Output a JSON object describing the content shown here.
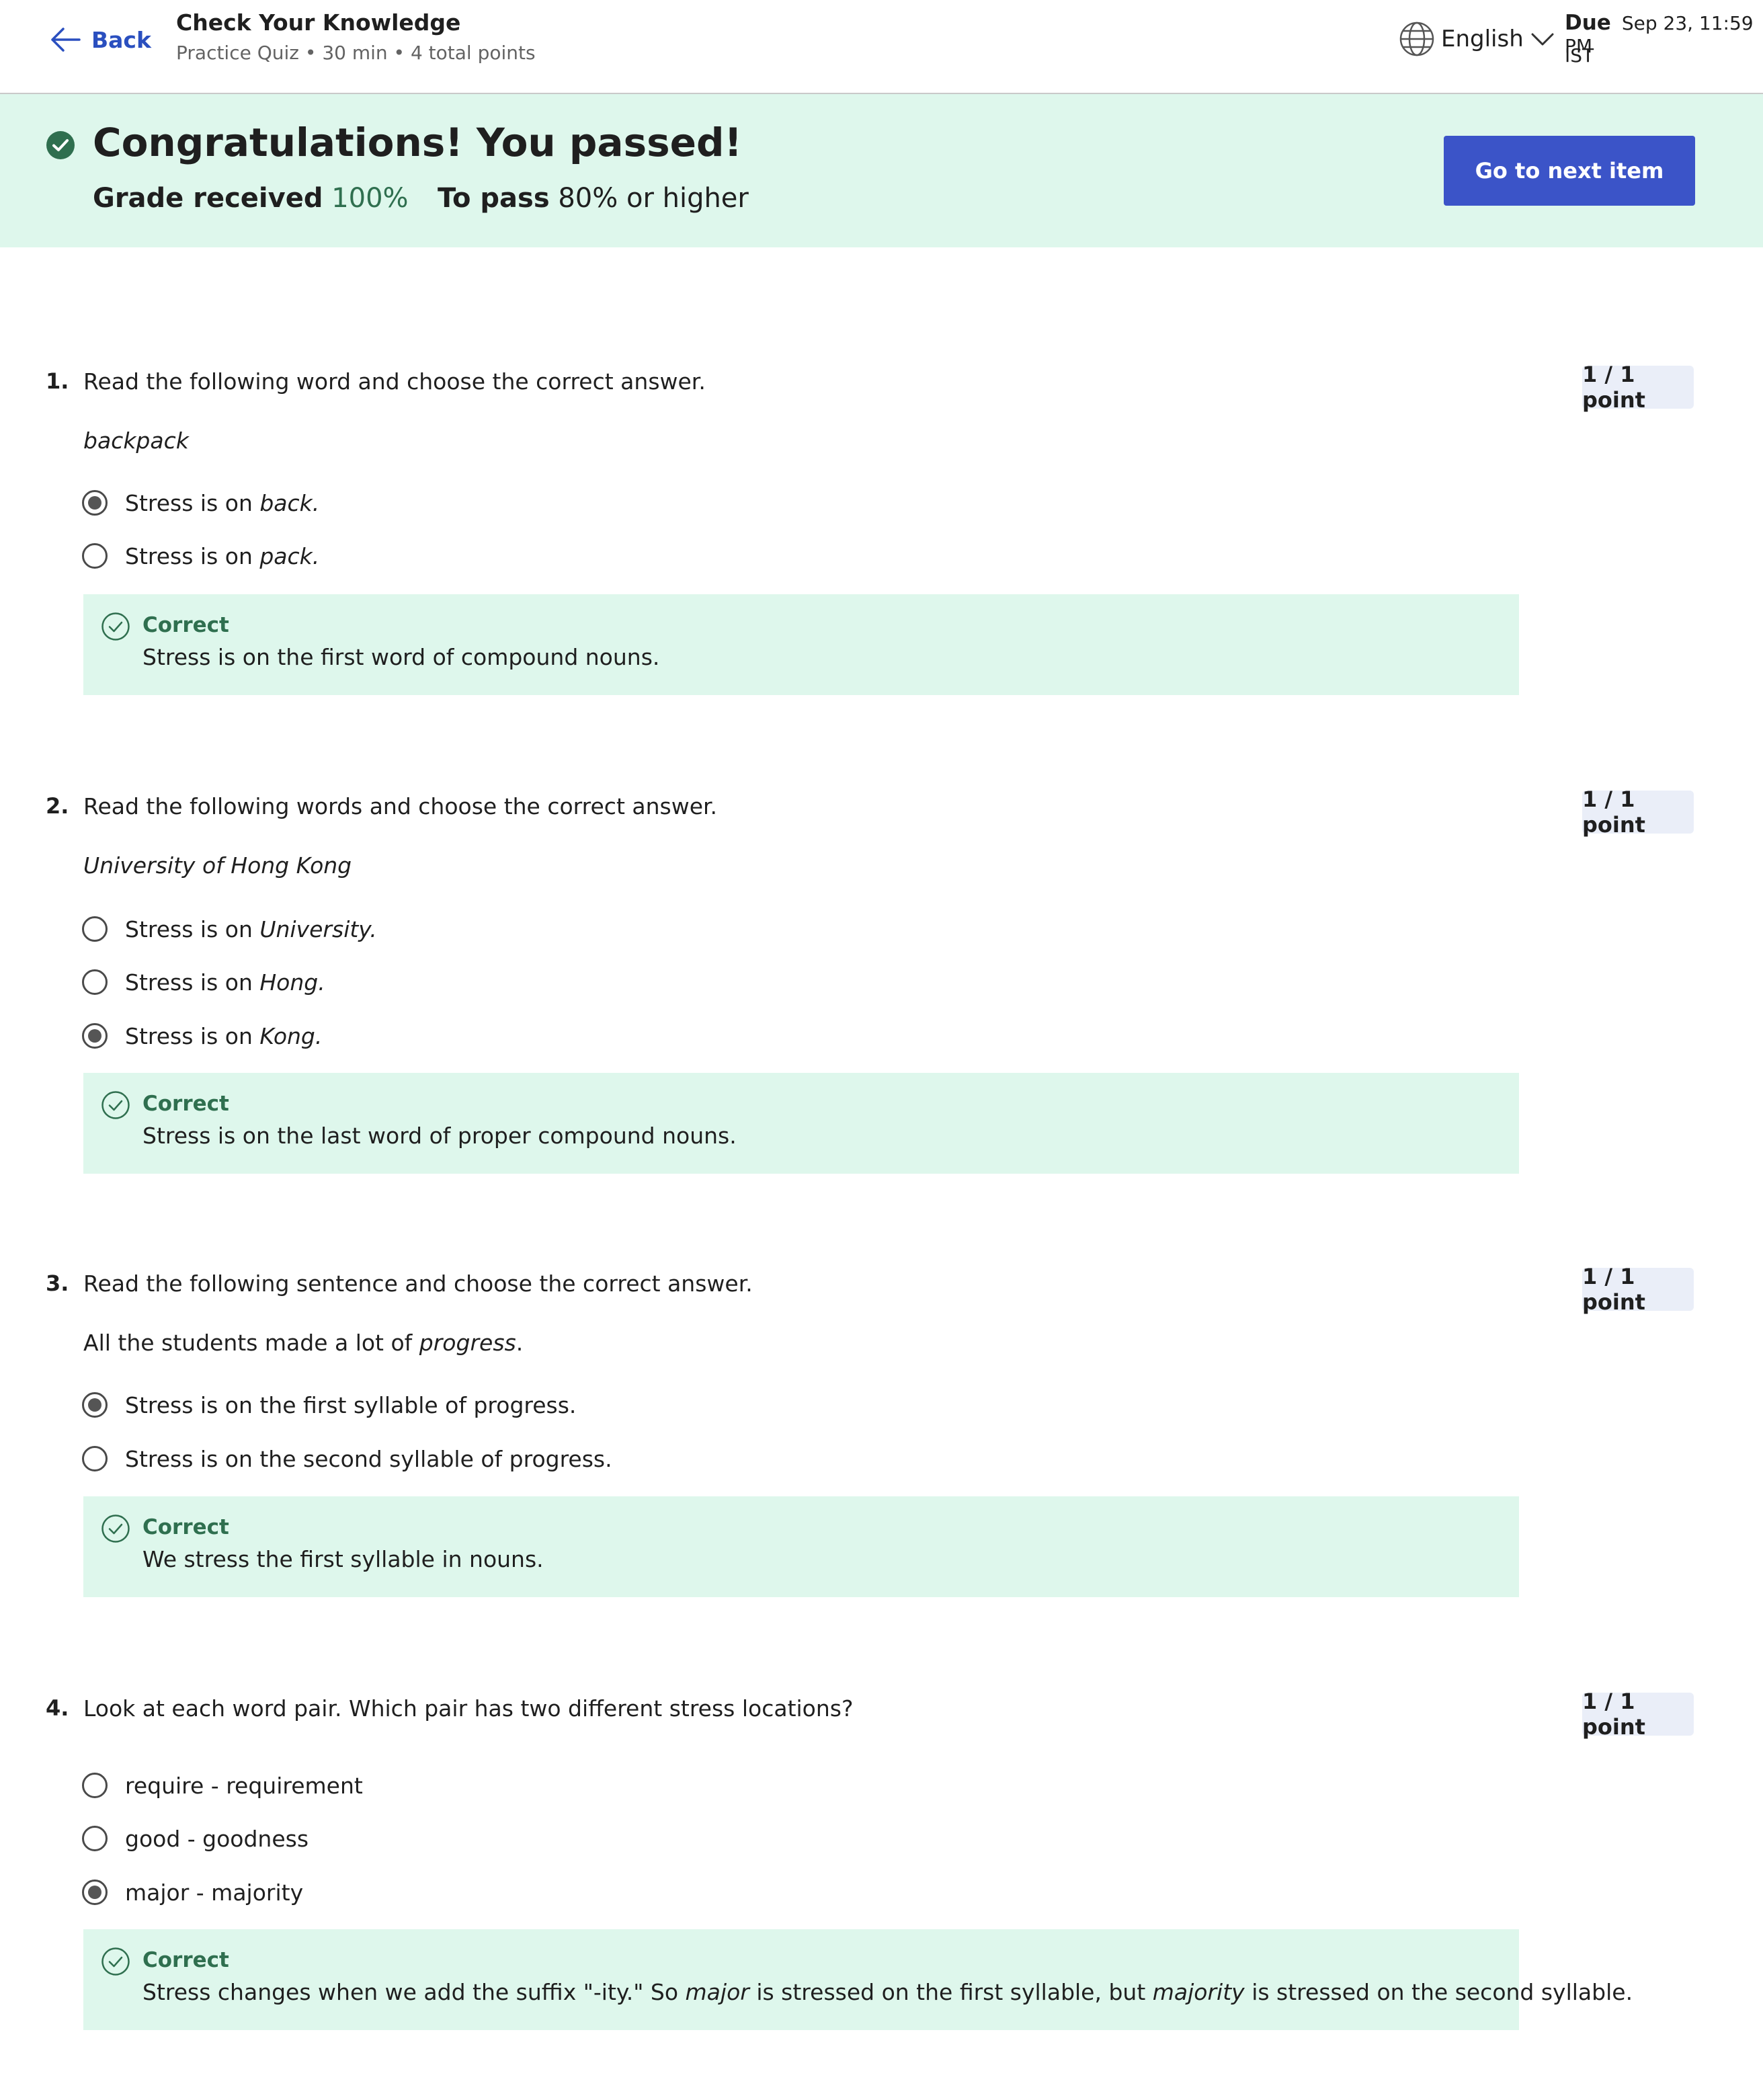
{
  "header": {
    "back_label": "Back",
    "title": "Check Your Knowledge",
    "subtitle": "Practice Quiz • 30 min • 4 total points",
    "language": "English",
    "due_label": "Due",
    "due_date": "Sep 23, 11:59 PM",
    "due_tz": "IST"
  },
  "banner": {
    "title": "Congratulations! You passed!",
    "grade_label": "Grade received",
    "grade_value": "100%",
    "pass_label": "To pass",
    "pass_value": "80% or higher",
    "next_button": "Go to next item"
  },
  "colors": {
    "accent": "#3b54c8",
    "success_bg": "#def7ec",
    "success_text": "#2f6f4f",
    "link": "#2a4fbf"
  },
  "questions": [
    {
      "number": "1.",
      "prompt": "Read the following word and choose the correct answer.",
      "points": "1 / 1 point",
      "stimulus": {
        "pre": "",
        "ital": "backpack",
        "post": ""
      },
      "options": [
        {
          "pre": "Stress is on ",
          "ital": "back.",
          "selected": true
        },
        {
          "pre": "Stress is on ",
          "ital": "pack.",
          "selected": false
        }
      ],
      "feedback_title": "Correct",
      "feedback": {
        "p1": "Stress is on the first word of compound nouns."
      }
    },
    {
      "number": "2.",
      "prompt": "Read the following words and choose the correct answer.",
      "points": "1 / 1 point",
      "stimulus": {
        "pre": "",
        "ital": "University of Hong Kong",
        "post": ""
      },
      "options": [
        {
          "pre": "Stress is on ",
          "ital": "University.",
          "selected": false
        },
        {
          "pre": "Stress is on ",
          "ital": "Hong.",
          "selected": false
        },
        {
          "pre": "Stress is on ",
          "ital": "Kong.",
          "selected": true
        }
      ],
      "feedback_title": "Correct",
      "feedback": {
        "p1": "Stress is on the last word of proper compound nouns."
      }
    },
    {
      "number": "3.",
      "prompt": "Read the following sentence and choose the correct answer.",
      "points": "1 / 1 point",
      "stimulus": {
        "pre": "All the students made a lot of ",
        "ital": "progress",
        "post": "."
      },
      "options": [
        {
          "pre": "Stress is on the first syllable of progress.",
          "ital": "",
          "selected": true
        },
        {
          "pre": "Stress is on the second syllable of progress.",
          "ital": "",
          "selected": false
        }
      ],
      "feedback_title": "Correct",
      "feedback": {
        "p1": "We stress the first syllable in nouns."
      }
    },
    {
      "number": "4.",
      "prompt": "Look at each word pair. Which pair has two different stress locations?",
      "points": "1 / 1 point",
      "options": [
        {
          "pre": "require - requirement",
          "ital": "",
          "selected": false
        },
        {
          "pre": "good - goodness",
          "ital": "",
          "selected": false
        },
        {
          "pre": "major - majority",
          "ital": "",
          "selected": true
        }
      ],
      "feedback_title": "Correct",
      "feedback": {
        "p1": "Stress changes when we add the suffix \"-ity.\" So ",
        "i1": "major",
        "p2": " is stressed on the first syllable, but ",
        "i2": "majority",
        "p3": " is stressed on the second syllable."
      }
    }
  ]
}
